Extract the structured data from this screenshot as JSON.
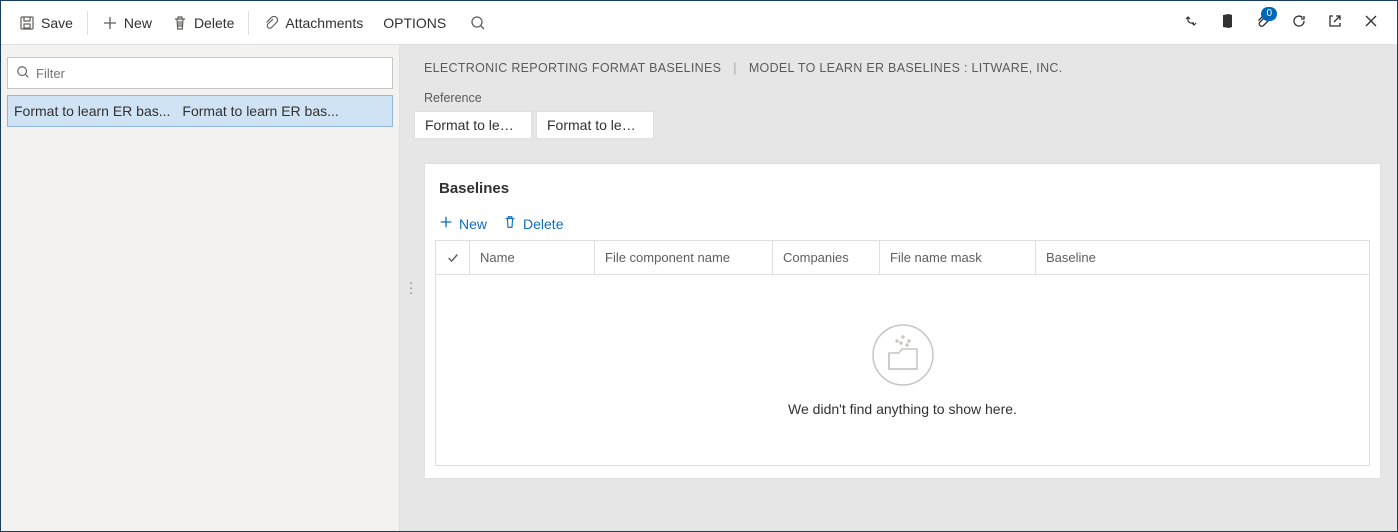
{
  "toolbar": {
    "save": "Save",
    "new": "New",
    "delete": "Delete",
    "attachments": "Attachments",
    "options": "OPTIONS"
  },
  "header_badge": "0",
  "left": {
    "filter_placeholder": "Filter",
    "rows": [
      {
        "col1": "Format to learn ER bas...",
        "col2": "Format to learn ER bas..."
      }
    ]
  },
  "breadcrumb": {
    "part1": "ELECTRONIC REPORTING FORMAT BASELINES",
    "part2": "MODEL TO LEARN ER BASELINES : LITWARE, INC."
  },
  "reference": {
    "label": "Reference",
    "items": [
      "Format to lear...",
      "Format to lear..."
    ]
  },
  "card": {
    "title": "Baselines",
    "new": "New",
    "delete": "Delete",
    "columns": {
      "name": "Name",
      "file_component_name": "File component name",
      "companies": "Companies",
      "file_name_mask": "File name mask",
      "baseline": "Baseline"
    },
    "empty": "We didn't find anything to show here."
  }
}
